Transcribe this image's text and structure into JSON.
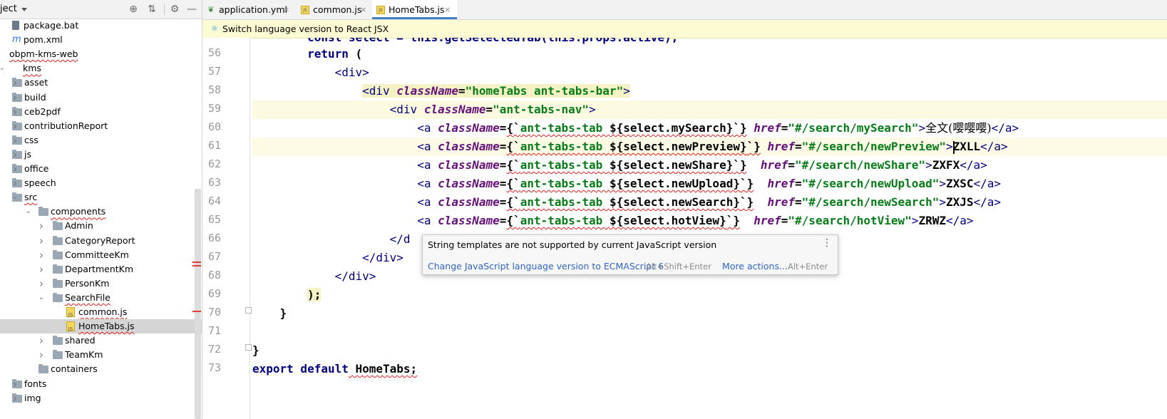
{
  "project_panel": {
    "title": "ject",
    "toolbar_icons": [
      "target-icon",
      "collapse-icon",
      "gear-icon",
      "minimize-icon"
    ],
    "tree": [
      {
        "label": "package.bat",
        "icon": "bat-file-icon",
        "depth": 1,
        "arrow": ""
      },
      {
        "label": "pom.xml",
        "icon": "maven-file-icon",
        "depth": 1,
        "arrow": ""
      },
      {
        "label": "obpm-kms-web",
        "icon": "",
        "depth": 0,
        "arrow": ""
      },
      {
        "label": "kms",
        "icon": "",
        "depth": 0,
        "arrow": "expanded"
      },
      {
        "label": "asset",
        "icon": "folder-icon",
        "depth": 1,
        "arrow": "collapsed"
      },
      {
        "label": "build",
        "icon": "folder-icon",
        "depth": 1,
        "arrow": "collapsed"
      },
      {
        "label": "ceb2pdf",
        "icon": "folder-icon",
        "depth": 1,
        "arrow": "collapsed"
      },
      {
        "label": "contributionReport",
        "icon": "folder-icon",
        "depth": 1,
        "arrow": "collapsed"
      },
      {
        "label": "css",
        "icon": "folder-icon",
        "depth": 1,
        "arrow": "collapsed"
      },
      {
        "label": "js",
        "icon": "folder-icon",
        "depth": 1,
        "arrow": "collapsed"
      },
      {
        "label": "office",
        "icon": "folder-icon",
        "depth": 1,
        "arrow": "collapsed"
      },
      {
        "label": "speech",
        "icon": "folder-icon",
        "depth": 1,
        "arrow": "collapsed"
      },
      {
        "label": "src",
        "icon": "folder-icon",
        "depth": 1,
        "arrow": "expanded"
      },
      {
        "label": "components",
        "icon": "folder-icon",
        "depth": 2,
        "arrow": "expanded"
      },
      {
        "label": "Admin",
        "icon": "folder-icon",
        "depth": 3,
        "arrow": "collapsed"
      },
      {
        "label": "CategoryReport",
        "icon": "folder-icon",
        "depth": 3,
        "arrow": "collapsed"
      },
      {
        "label": "CommitteeKm",
        "icon": "folder-icon",
        "depth": 3,
        "arrow": "collapsed"
      },
      {
        "label": "DepartmentKm",
        "icon": "folder-icon",
        "depth": 3,
        "arrow": "collapsed"
      },
      {
        "label": "PersonKm",
        "icon": "folder-icon",
        "depth": 3,
        "arrow": "collapsed"
      },
      {
        "label": "SearchFile",
        "icon": "folder-icon",
        "depth": 3,
        "arrow": "expanded"
      },
      {
        "label": "common.js",
        "icon": "js-file-icon",
        "depth": 4,
        "arrow": ""
      },
      {
        "label": "HomeTabs.js",
        "icon": "js-file-icon",
        "depth": 4,
        "arrow": "",
        "selected": true
      },
      {
        "label": "shared",
        "icon": "folder-icon",
        "depth": 3,
        "arrow": "collapsed"
      },
      {
        "label": "TeamKm",
        "icon": "folder-icon",
        "depth": 3,
        "arrow": "collapsed"
      },
      {
        "label": "containers",
        "icon": "folder-icon",
        "depth": 2,
        "arrow": ""
      },
      {
        "label": "fonts",
        "icon": "folder-icon",
        "depth": 1,
        "arrow": "collapsed"
      },
      {
        "label": "img",
        "icon": "folder-icon",
        "depth": 1,
        "arrow": "collapsed"
      }
    ]
  },
  "editor": {
    "tabs": [
      {
        "label": "application.yml",
        "icon": "yml-file-icon",
        "active": false
      },
      {
        "label": "common.js",
        "icon": "js-file-icon",
        "active": false
      },
      {
        "label": "HomeTabs.js",
        "icon": "js-file-icon",
        "active": true
      }
    ],
    "close_glyph": "×",
    "banner": {
      "icon": "react-icon",
      "text": "Switch language version to React JSX"
    },
    "line_numbers": [
      "56",
      "57",
      "58",
      "59",
      "60",
      "61",
      "62",
      "63",
      "64",
      "65",
      "66",
      "67",
      "68",
      "69",
      "70",
      "71",
      "72",
      "73"
    ],
    "code": {
      "l55": "        const select = this.getSelectedTab(this.props.active);",
      "return_kw": "return",
      "paren_open": " (",
      "div_open": "<div>",
      "div_tag": "<div",
      "classname_attr": "className",
      "eq": "=",
      "hometabs_val": "\"homeTabs ant-tabs-bar\"",
      "tabsnav_val": "\"ant-tabs-nav\"",
      "gt": ">",
      "a_tag": "<a",
      "brace_open": "{`",
      "tab_cls": "ant-tabs-tab ",
      "brace_close": "`}",
      "href_attr": "href",
      "links": [
        {
          "expr": "${select.mySearch}",
          "href": "\"#/search/mySearch\"",
          "text_a": "全文",
          "text_b": "(嘤嘤嘤)",
          "pad": " "
        },
        {
          "expr": "${select.newPreview}",
          "href": "\"#/search/newPreview\"",
          "text_a": "",
          "text_b": "ZXLL",
          "pad": " "
        },
        {
          "expr": "${select.newShare}",
          "href": "\"#/search/newShare\"",
          "text_a": "",
          "text_b": "ZXFX",
          "pad": "  "
        },
        {
          "expr": "${select.newUpload}",
          "href": "\"#/search/newUpload\"",
          "text_a": "",
          "text_b": "ZXSC",
          "pad": "  "
        },
        {
          "expr": "${select.newSearch}",
          "href": "\"#/search/newSearch\"",
          "text_a": "",
          "text_b": "ZXJS",
          "pad": "  "
        },
        {
          "expr": "${select.hotView}",
          "href": "\"#/search/hotView\"",
          "text_a": "",
          "text_b": "ZRWZ",
          "pad": "  "
        }
      ],
      "a_close": "</a>",
      "div_close_partial": "</d",
      "div_close": "</div>",
      "paren_close": ");",
      "brace_close_fn": "}",
      "brace_close_cls": "}",
      "export_kw": "export default",
      "export_name": " HomeTabs;"
    }
  },
  "tooltip": {
    "message": "String templates are not supported by current JavaScript version",
    "more_icon": "⋮",
    "fix_label": "Change JavaScript language version to ECMAScript 6",
    "fix_shortcut": "Alt+Shift+Enter",
    "more_actions_label": "More actions...",
    "more_actions_shortcut": "Alt+Enter"
  }
}
